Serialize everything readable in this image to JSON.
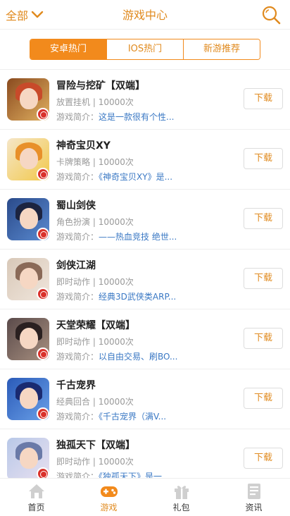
{
  "header": {
    "filter_label": "全部",
    "title": "游戏中心"
  },
  "tabs": [
    {
      "label": "安卓热门",
      "active": true
    },
    {
      "label": "IOS热门",
      "active": false
    },
    {
      "label": "新游推荐",
      "active": false
    }
  ],
  "intro_prefix": "游戏简介：",
  "download_label": "下载",
  "games": [
    {
      "name": "冒险与挖矿【双端】",
      "genre": "放置挂机",
      "downloads": "10000次",
      "intro": "这是一款很有个性...",
      "colors": [
        "#8a4a1f",
        "#e0b060",
        "#c84a2a"
      ]
    },
    {
      "name": "神奇宝贝XY",
      "genre": "卡牌策略",
      "downloads": "10000次",
      "intro": "《神奇宝贝XY》是...",
      "colors": [
        "#f5e6c8",
        "#f2c84a",
        "#e8902a"
      ]
    },
    {
      "name": "蜀山剑侠",
      "genre": "角色扮演",
      "downloads": "10000次",
      "intro": "——热血竞技 绝世...",
      "colors": [
        "#2a4a8a",
        "#5a8ad0",
        "#1c2440"
      ]
    },
    {
      "name": "剑侠江湖",
      "genre": "即时动作",
      "downloads": "10000次",
      "intro": "经典3D武侠类ARP...",
      "colors": [
        "#d8c8b8",
        "#f0e6dc",
        "#8a6a58"
      ]
    },
    {
      "name": "天堂荣耀【双端】",
      "genre": "即时动作",
      "downloads": "10000次",
      "intro": "以自由交易、刷BO...",
      "colors": [
        "#5a4a4a",
        "#a89080",
        "#2a2020"
      ]
    },
    {
      "name": "千古宠界",
      "genre": "经典回合",
      "downloads": "10000次",
      "intro": "《千古宠界（满V...",
      "colors": [
        "#2a5ab8",
        "#6aa0e8",
        "#1a2a70"
      ]
    },
    {
      "name": "独孤天下【双端】",
      "genre": "即时动作",
      "downloads": "10000次",
      "intro": "《独孤天下》是一...",
      "colors": [
        "#b8c8e8",
        "#e8e0f0",
        "#6a7aa8"
      ]
    }
  ],
  "nav": [
    {
      "label": "首页",
      "icon": "home-icon",
      "active": false
    },
    {
      "label": "游戏",
      "icon": "gamepad-icon",
      "active": true
    },
    {
      "label": "礼包",
      "icon": "gift-icon",
      "active": false
    },
    {
      "label": "资讯",
      "icon": "news-icon",
      "active": false
    }
  ],
  "colors": {
    "accent": "#f28a1c",
    "link": "#3a78c4"
  }
}
